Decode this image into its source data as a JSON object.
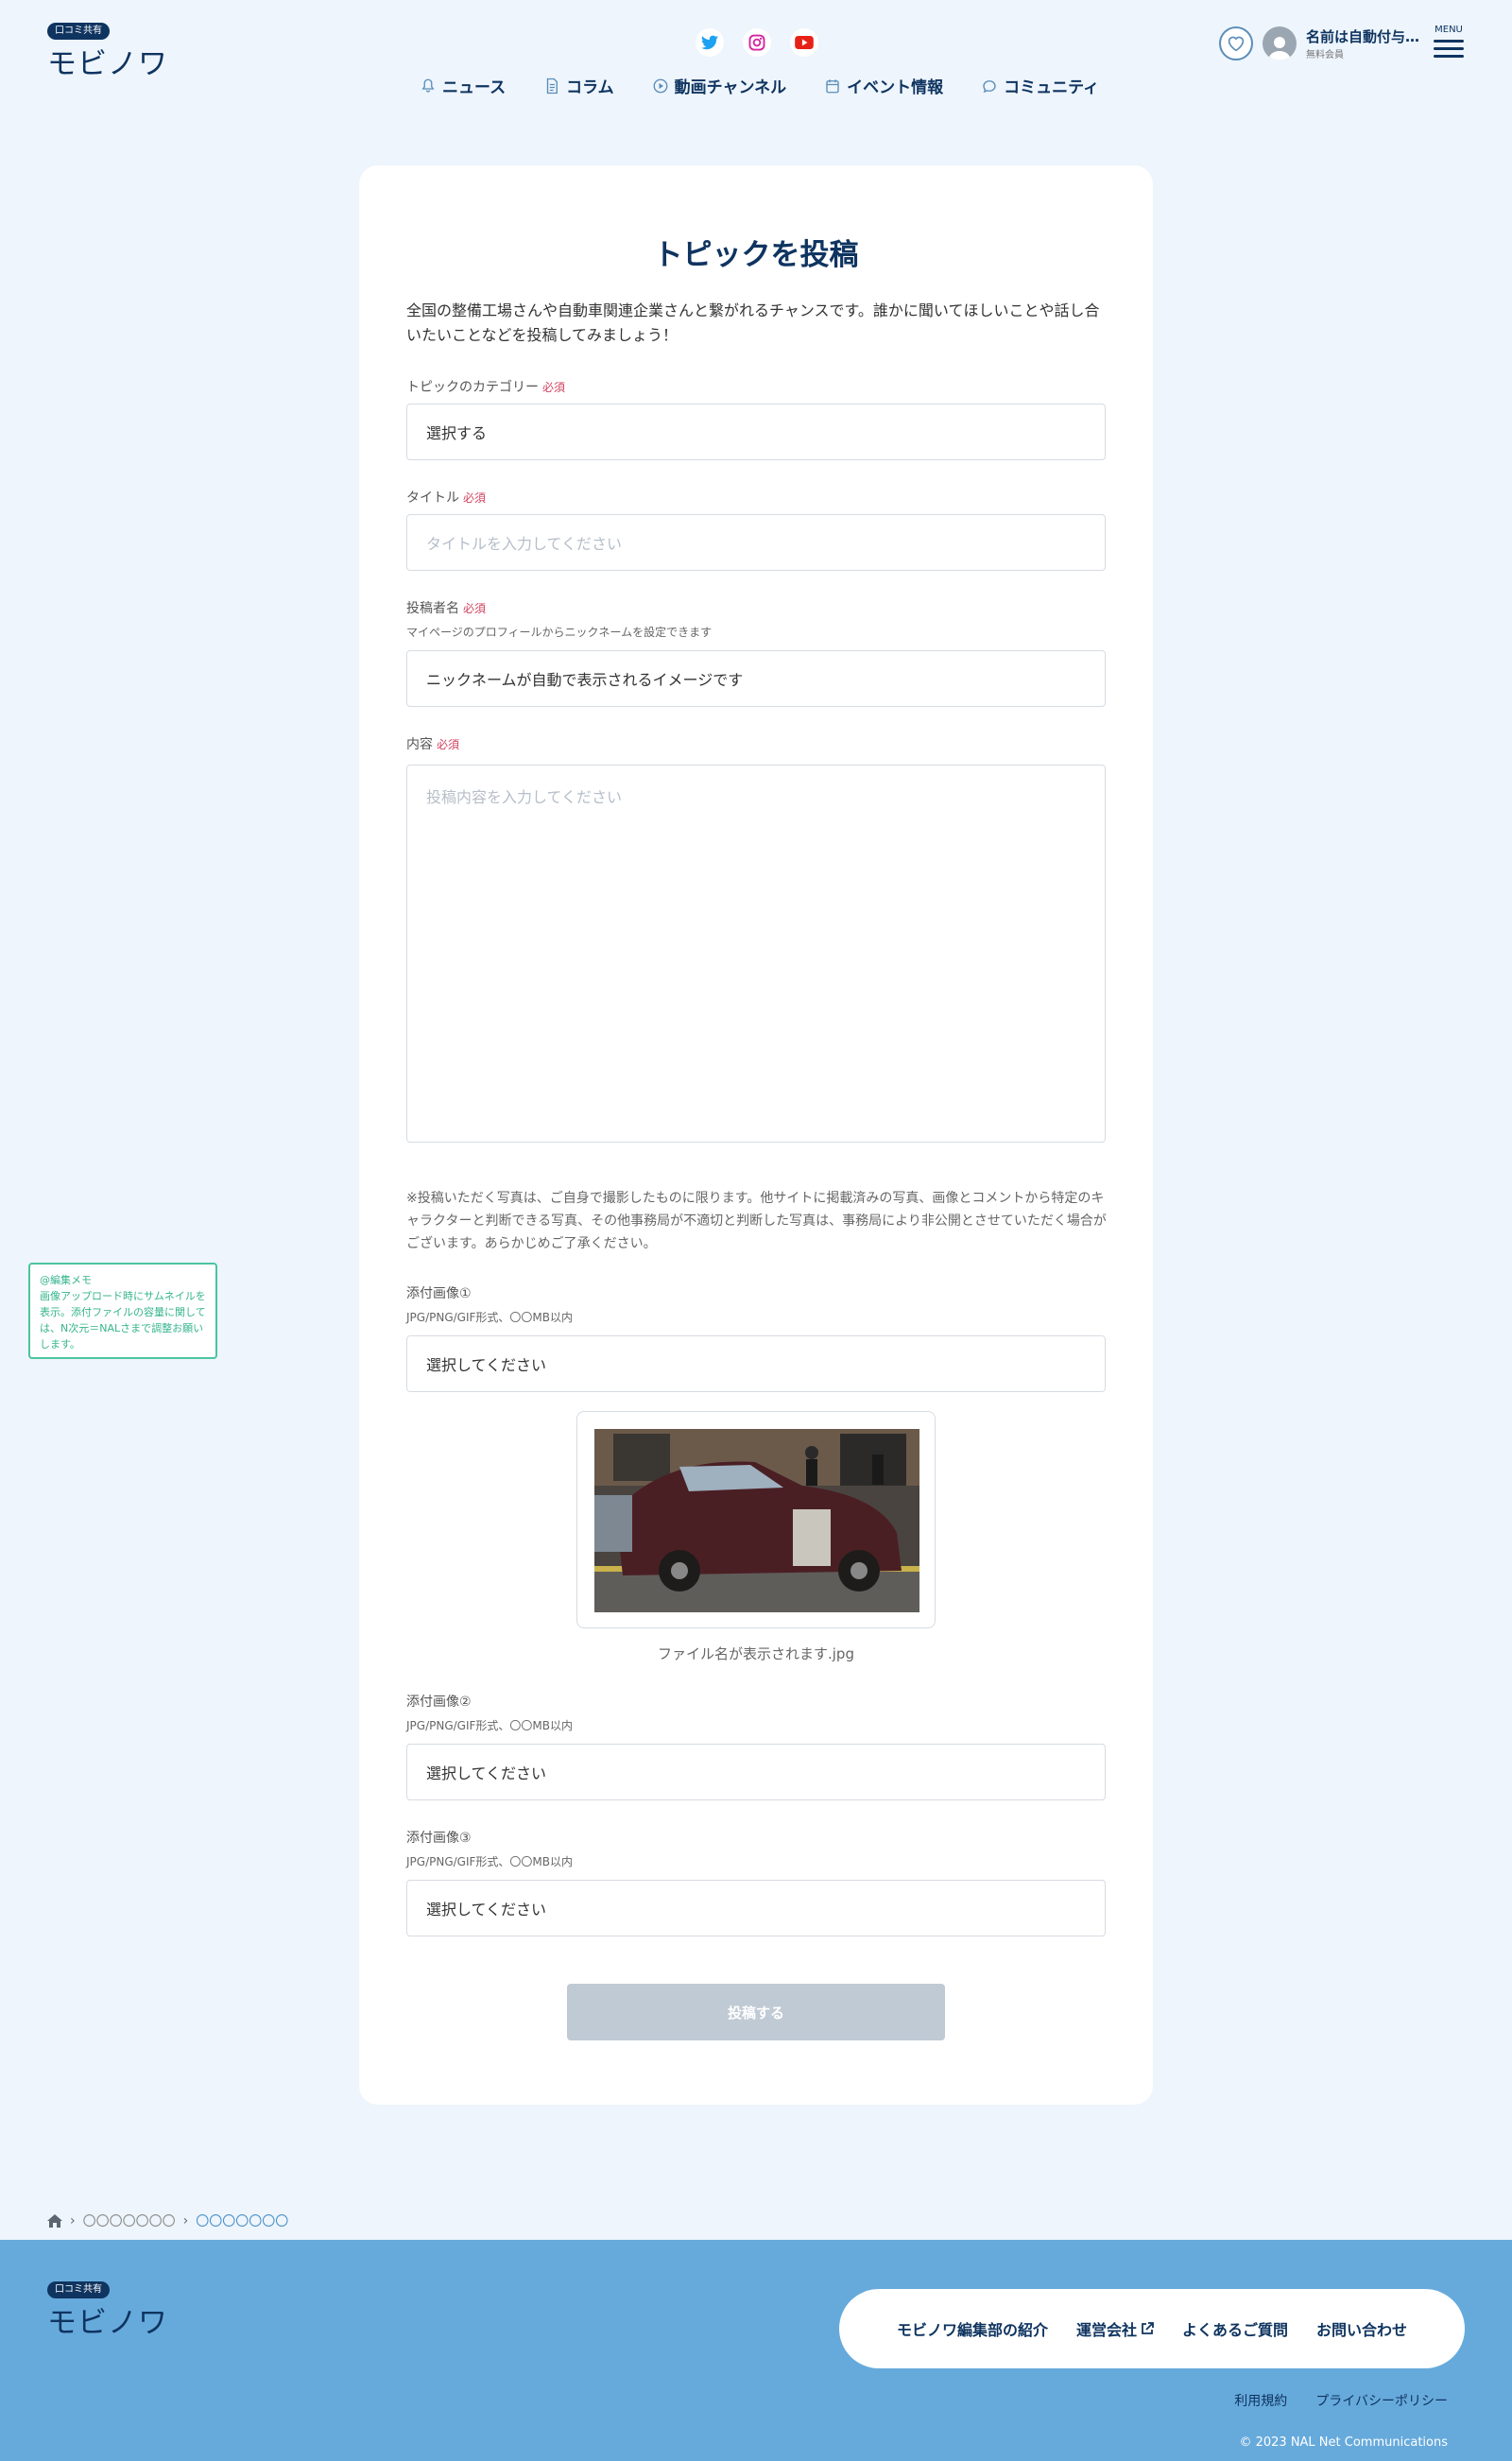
{
  "header": {
    "logo_badge": "口コミ共有",
    "logo_text": "モビノワ",
    "nav": [
      {
        "label": "ニュース",
        "icon": "bell-icon"
      },
      {
        "label": "コラム",
        "icon": "document-icon"
      },
      {
        "label": "動画チャンネル",
        "icon": "play-icon"
      },
      {
        "label": "イベント情報",
        "icon": "calendar-icon"
      },
      {
        "label": "コミュニティ",
        "icon": "community-icon"
      }
    ],
    "user_name": "名前は自動付与…",
    "user_rank": "無料会員",
    "menu_label": "MENU"
  },
  "form": {
    "title": "トピックを投稿",
    "lead": "全国の整備工場さんや自動車関連企業さんと繋がれるチャンスです。誰かに聞いてほしいことや話し合いたいことなどを投稿してみましょう！",
    "required": "必須",
    "category_label": "トピックのカテゴリー",
    "category_value": "選択する",
    "title_label": "タイトル",
    "title_placeholder": "タイトルを入力してください",
    "author_label": "投稿者名",
    "author_note": "マイページのプロフィールからニックネームを設定できます",
    "author_value": "ニックネームが自動で表示されるイメージです",
    "content_label": "内容",
    "content_placeholder": "投稿内容を入力してください",
    "notice": "※投稿いただく写真は、ご自身で撮影したものに限ります。他サイトに掲載済みの写真、画像とコメントから特定のキャラクターと判断できる写真、その他事務局が不適切と判断した写真は、事務局により非公開とさせていただく場合がございます。あらかじめご了承ください。",
    "image1_label": "添付画像①",
    "image2_label": "添付画像②",
    "image3_label": "添付画像③",
    "image_note": "JPG/PNG/GIF形式、〇〇MB以内",
    "image_select": "選択してください",
    "file_name": "ファイル名が表示されます.jpg",
    "submit": "投稿する"
  },
  "edit_memo": {
    "title": "@編集メモ",
    "body": "画像アップロード時にサムネイルを表示。添付ファイルの容量に関しては、N次元＝NALさまで調整お願いします。"
  },
  "breadcrumb": [
    "〇〇〇〇〇〇〇",
    "〇〇〇〇〇〇〇"
  ],
  "footer": {
    "nav": [
      "モビノワ編集部の紹介",
      "運営会社",
      "よくあるご質問",
      "お問い合わせ"
    ],
    "sub": [
      "利用規約",
      "プライバシーポリシー"
    ],
    "copyright": "© 2023 NAL Net Communications"
  },
  "colors": {
    "primary": "#0f3460",
    "background": "#eef5fc",
    "footer": "#66aadc",
    "required": "#d0425e",
    "memo": "#35b48d",
    "button_disabled": "#c0cad5"
  }
}
